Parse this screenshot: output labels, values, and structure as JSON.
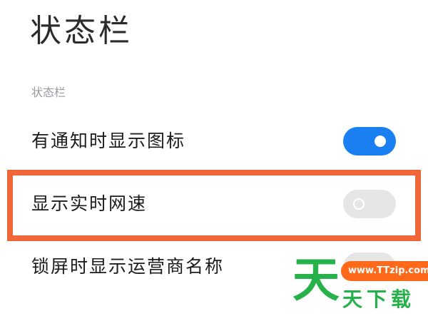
{
  "page": {
    "title": "状态栏",
    "section_header": "状态栏"
  },
  "settings": [
    {
      "label": "有通知时显示图标",
      "enabled": true
    },
    {
      "label": "显示实时网速",
      "enabled": false
    },
    {
      "label": "锁屏时显示运营商名称",
      "enabled": false
    }
  ],
  "watermark": {
    "url": "www.TTzip.com",
    "big_char": "天",
    "text": "天下载"
  },
  "colors": {
    "toggle_on": "#1a7ff0",
    "toggle_off": "#e6e6e6",
    "highlight": "#f2673a",
    "watermark_green": "#27b14b",
    "watermark_orange": "#ff6a1a"
  }
}
